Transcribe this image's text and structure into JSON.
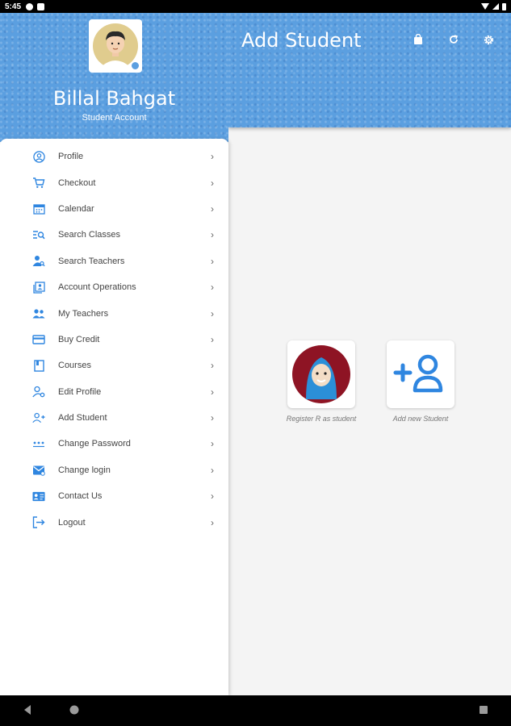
{
  "status_bar": {
    "time": "5:45"
  },
  "header": {
    "title": "Add Student",
    "actions": [
      "bag-icon",
      "refresh-icon",
      "settings-icon"
    ]
  },
  "drawer": {
    "user_name": "Billal Bahgat",
    "user_role": "Student Account",
    "items": [
      {
        "label": "Profile",
        "icon": "profile-icon"
      },
      {
        "label": "Checkout",
        "icon": "cart-icon"
      },
      {
        "label": "Calendar",
        "icon": "calendar-icon"
      },
      {
        "label": "Search Classes",
        "icon": "search-classes-icon"
      },
      {
        "label": "Search Teachers",
        "icon": "search-teachers-icon"
      },
      {
        "label": "Account Operations",
        "icon": "account-operations-icon"
      },
      {
        "label": "My Teachers",
        "icon": "teachers-icon"
      },
      {
        "label": "Buy Credit",
        "icon": "credit-card-icon"
      },
      {
        "label": "Courses",
        "icon": "courses-icon"
      },
      {
        "label": "Edit Profile",
        "icon": "edit-profile-icon"
      },
      {
        "label": "Add Student",
        "icon": "add-student-icon"
      },
      {
        "label": "Change Password",
        "icon": "password-icon"
      },
      {
        "label": "Change login",
        "icon": "email-icon"
      },
      {
        "label": "Contact Us",
        "icon": "contact-icon"
      },
      {
        "label": "Logout",
        "icon": "logout-icon"
      }
    ],
    "chevron": "›"
  },
  "cards": [
    {
      "label": "Register R as student"
    },
    {
      "label": "Add new Student"
    }
  ],
  "colors": {
    "accent": "#5b9fe0",
    "icon": "#2f86e0"
  }
}
